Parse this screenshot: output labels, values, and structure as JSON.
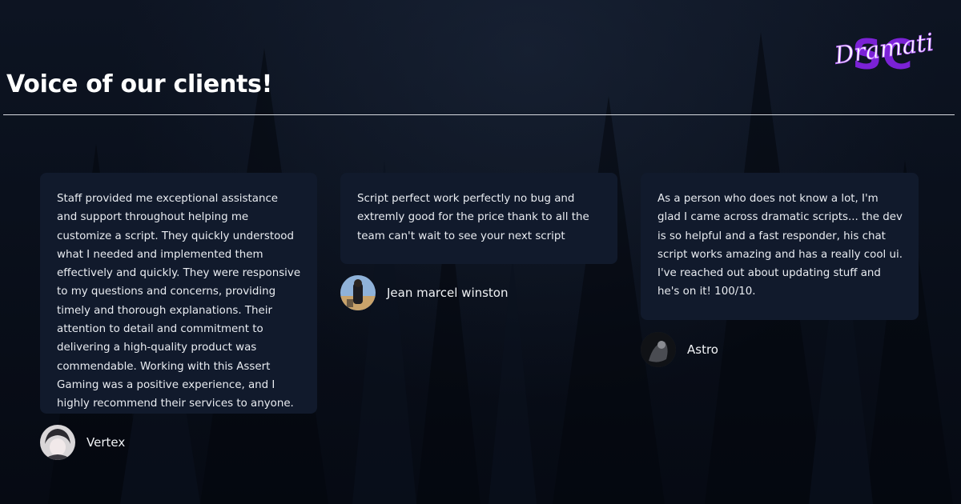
{
  "page": {
    "title": "Voice of our clients!"
  },
  "logo": {
    "text": "Dramatic",
    "letters": "SC"
  },
  "testimonials": [
    {
      "text": "Staff provided me exceptional assistance and support throughout helping me customize a script. They quickly understood what I needed and implemented them effectively and quickly. They were responsive to my questions and concerns, providing timely and thorough explanations. Their attention to detail and commitment to delivering a high-quality product was commendable. Working with this Assert Gaming was a positive experience, and I highly recommend their services to anyone.",
      "author": "Vertex"
    },
    {
      "text": "Script perfect work perfectly no bug and extremly good for the price thank to all the team can't wait to see your next script",
      "author": "Jean marcel winston"
    },
    {
      "text": "As a person who does not know a lot, I'm glad I came across dramatic scripts... the dev is so helpful and a fast responder, his chat script works amazing and has a really cool ui. I've reached out about updating stuff and he's on it! 100/10.",
      "author": "Astro"
    }
  ],
  "colors": {
    "card": "#111a2c",
    "accent": "#7b22d6",
    "background": "#070b15"
  }
}
